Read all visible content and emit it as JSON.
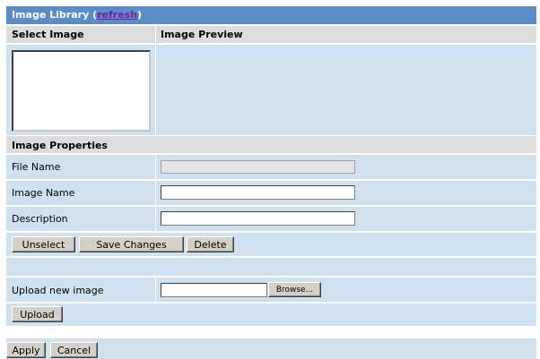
{
  "library": {
    "title": "Image Library (",
    "refresh_link": "refresh",
    "title_suffix": ")"
  },
  "headers": {
    "select_image": "Select Image",
    "image_preview": "Image Preview"
  },
  "properties": {
    "heading": "Image Properties",
    "file_name_label": "File Name",
    "file_name_value": "",
    "image_name_label": "Image Name",
    "image_name_value": "",
    "description_label": "Description",
    "description_value": ""
  },
  "actions": {
    "unselect": "Unselect",
    "save_changes": "Save Changes",
    "delete": "Delete"
  },
  "upload": {
    "label": "Upload new image",
    "file_value": "",
    "browse": "Browse...",
    "upload_button": "Upload"
  },
  "footer": {
    "apply": "Apply",
    "cancel": "Cancel"
  },
  "colors": {
    "title_bar": "#5a8dc8",
    "header_bg": "#dcdcdc",
    "cell_bg": "#cfe1ee",
    "link": "#7a1fa3"
  }
}
